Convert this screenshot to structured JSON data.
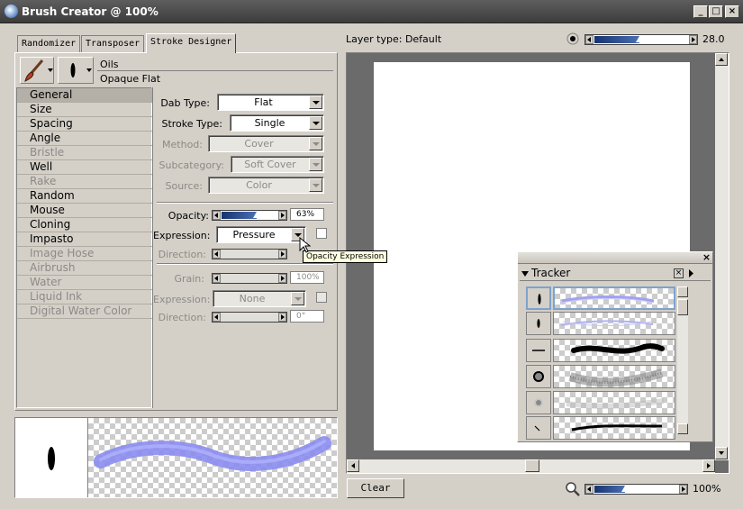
{
  "window": {
    "title": "Brush Creator @ 100%"
  },
  "tabs": [
    {
      "label": "Randomizer",
      "active": false
    },
    {
      "label": "Transposer",
      "active": false
    },
    {
      "label": "Stroke Designer",
      "active": true
    }
  ],
  "brush": {
    "category": "Oils",
    "variant": "Opaque Flat"
  },
  "nav": [
    {
      "label": "General",
      "enabled": true,
      "selected": true
    },
    {
      "label": "Size",
      "enabled": true
    },
    {
      "label": "Spacing",
      "enabled": true
    },
    {
      "label": "Angle",
      "enabled": true
    },
    {
      "label": "Bristle",
      "enabled": false
    },
    {
      "label": "Well",
      "enabled": true
    },
    {
      "label": "Rake",
      "enabled": false
    },
    {
      "label": "Random",
      "enabled": true
    },
    {
      "label": "Mouse",
      "enabled": true
    },
    {
      "label": "Cloning",
      "enabled": true
    },
    {
      "label": "Impasto",
      "enabled": true
    },
    {
      "label": "Image Hose",
      "enabled": false
    },
    {
      "label": "Airbrush",
      "enabled": false
    },
    {
      "label": "Water",
      "enabled": false
    },
    {
      "label": "Liquid Ink",
      "enabled": false
    },
    {
      "label": "Digital Water Color",
      "enabled": false
    }
  ],
  "general": {
    "dab_type": {
      "label": "Dab Type:",
      "value": "Flat"
    },
    "stroke_type": {
      "label": "Stroke Type:",
      "value": "Single"
    },
    "method": {
      "label": "Method:",
      "value": "Cover"
    },
    "subcategory": {
      "label": "Subcategory:",
      "value": "Soft Cover"
    },
    "source": {
      "label": "Source:",
      "value": "Color"
    },
    "opacity": {
      "label": "Opacity:",
      "value": "63%",
      "fraction": 0.63
    },
    "opacity_expression": {
      "label": "Expression:",
      "value": "Pressure"
    },
    "opacity_direction": {
      "label": "Direction:"
    },
    "tooltip": "Opacity Expression",
    "grain": {
      "label": "Grain:",
      "value": "100%",
      "fraction": 1.0
    },
    "grain_expression": {
      "label": "Expression:",
      "value": "None"
    },
    "grain_direction": {
      "label": "Direction:",
      "value": "0°",
      "fraction": 0.0
    }
  },
  "canvas": {
    "layer_type": "Layer type: Default",
    "size_value": "28.0",
    "size_fraction": 0.48,
    "zoom_value": "100%",
    "zoom_fraction": 0.37,
    "clear_label": "Clear"
  },
  "tracker": {
    "title": "Tracker"
  },
  "colors": {
    "accent": "#1b3a78",
    "stroke_preview": "#8a8cf0",
    "title_bar": "#4a4a4a"
  }
}
